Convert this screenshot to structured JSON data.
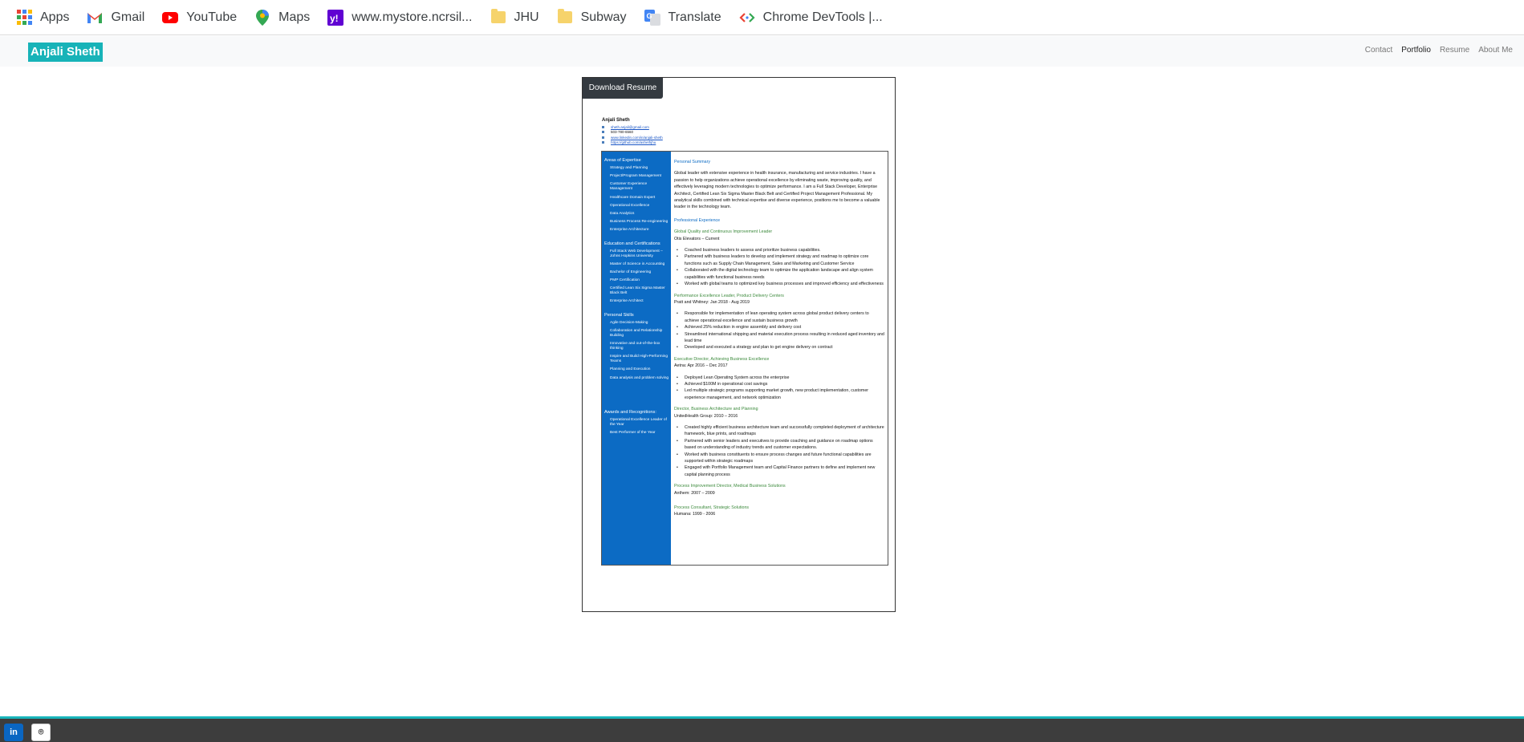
{
  "bookmarks": [
    {
      "label": "Apps",
      "icon": "apps-grid-icon"
    },
    {
      "label": "Gmail",
      "icon": "gmail-icon"
    },
    {
      "label": "YouTube",
      "icon": "youtube-icon"
    },
    {
      "label": "Maps",
      "icon": "maps-pin-icon"
    },
    {
      "label": "www.mystore.ncrsil...",
      "icon": "yahoo-icon"
    },
    {
      "label": "JHU",
      "icon": "folder-icon"
    },
    {
      "label": "Subway",
      "icon": "folder-icon"
    },
    {
      "label": "Translate",
      "icon": "translate-icon"
    },
    {
      "label": "Chrome DevTools |...",
      "icon": "devtools-icon"
    }
  ],
  "nav": {
    "brand": "Anjali Sheth",
    "links": [
      "Contact",
      "Portfolio",
      "Resume",
      "About Me"
    ],
    "active": "Portfolio"
  },
  "resume": {
    "download_label": "Download Resume",
    "name": "Anjali Sheth",
    "contacts": [
      "sheth.anjali@gmail.com",
      "503-780-6560",
      "www.linkedin.com/in/anjali-sheth",
      "https://github.com/ashethjhu"
    ],
    "sidebar": {
      "expertise_title": "Areas of Expertise",
      "expertise": [
        "Strategy and Planning",
        "Project/Program Management",
        "Customer Experience Management",
        "Healthcare Domain Expert",
        "Operational Excellence",
        "Data Analytics",
        "Business Process Re-engineering",
        "Enterprise Architecture"
      ],
      "education_title": "Education and Certifications",
      "education": [
        "Full Stack Web Development – Johns Hopkins University",
        "Master of Science in Accounting",
        "Bachelor of Engineering",
        "PMP Certification",
        "Certified Lean Six Sigma Master Black Belt",
        "Enterprise Architect"
      ],
      "skills_title": "Personal Skills",
      "skills": [
        "Agile Decision-Making",
        "Collaboration and Relationship Building",
        "Innovative and out-of-the-box thinking",
        "Inspire and Build High-Performing Teams",
        "Planning and Execution",
        "Data analysis and problem solving"
      ],
      "awards_title": "Awards and Recognitions:",
      "awards": [
        "Operational Excellence Leader of the Year",
        "Best Performer of the Year"
      ]
    },
    "summary_title": "Personal Summary",
    "summary": "Global leader with extensive experience in health insurance, manufacturing and service industries. I have a passion to help organizations achieve operational excellence by eliminating waste, improving quality, and effectively leveraging modern technologies to optimize performance. I am a Full Stack Developer, Enterprise Architect, Certified Lean Six Sigma Master Black Belt and Certified Project Management Professional. My analytical skills combined with technical expertise and diverse experience, positions me to become a valuable leader in the technology team.",
    "experience_title": "Professional Experience",
    "jobs": [
      {
        "title": "Global Quality and Continuous Improvement Leader",
        "org": "Otis Elevators – Current",
        "bullets": [
          "Coached business leaders to assess and prioritize business capabilities.",
          "Partnered with business leaders to develop and implement strategy and roadmap to optimize core functions such as Supply Chain Management, Sales and Marketing and Customer Service",
          "Collaborated with the digital technology team to optimize the application landscape and align system capabilities with functional business needs",
          "Worked with global teams to optimized key business processes and improved efficiency and effectiveness"
        ]
      },
      {
        "title": "Performance Excellence Leader, Product Delivery Centers",
        "org": "Pratt and Whitney: Jan 2018 - Aug 2019",
        "bullets": [
          "Responsible for implementation of lean operating system across global product delivery centers to achieve operational excellence and sustain business growth",
          "Achieved 25% reduction in engine assembly and delivery cost",
          "Streamlined international shipping and material execution process resulting in reduced aged inventory and lead time",
          "Developed and executed a strategy and plan to get engine delivery on contract"
        ]
      },
      {
        "title": "Executive Director, Achieving Business Excellence",
        "org": "Aetna: Apr 2016 – Dec 2017",
        "bullets": [
          "Deployed Lean Operating System across the enterprise",
          "Achieved $100M in operational cost savings",
          "Led multiple strategic programs supporting market growth, new product implementation, customer experience management, and network optimization"
        ]
      },
      {
        "title": "Director, Business Architecture and Planning",
        "org": "UnitedHealth Group: 2010 – 2016",
        "bullets": [
          "Created highly efficient business architecture team and successfully completed deployment of architecture framework, blue prints, and roadmaps",
          "Partnered with senior leaders and executives to provide coaching and guidance on roadmap options based on understanding of industry trends and customer expectations.",
          "Worked with business constituents to ensure process changes and future functional capabilities are supported within strategic roadmaps",
          "Engaged with Portfolio Management team and Capital Finance partners to define and implement new capital planning process"
        ]
      },
      {
        "title": "Process Improvement Director, Medical Business Solutions",
        "org": "Anthem: 2007 – 2009",
        "bullets": []
      },
      {
        "title": "Process Consultant, Strategic Solutions",
        "org": "Humana: 1999 - 2006",
        "bullets": []
      }
    ]
  },
  "footer": {
    "linkedin_label": "in",
    "github_label": "⌾"
  },
  "colors": {
    "brand": "#17b3b8",
    "sidebar": "#0c6bc4",
    "footer": "#3d3d3d",
    "job_title": "#3c8a3c"
  }
}
